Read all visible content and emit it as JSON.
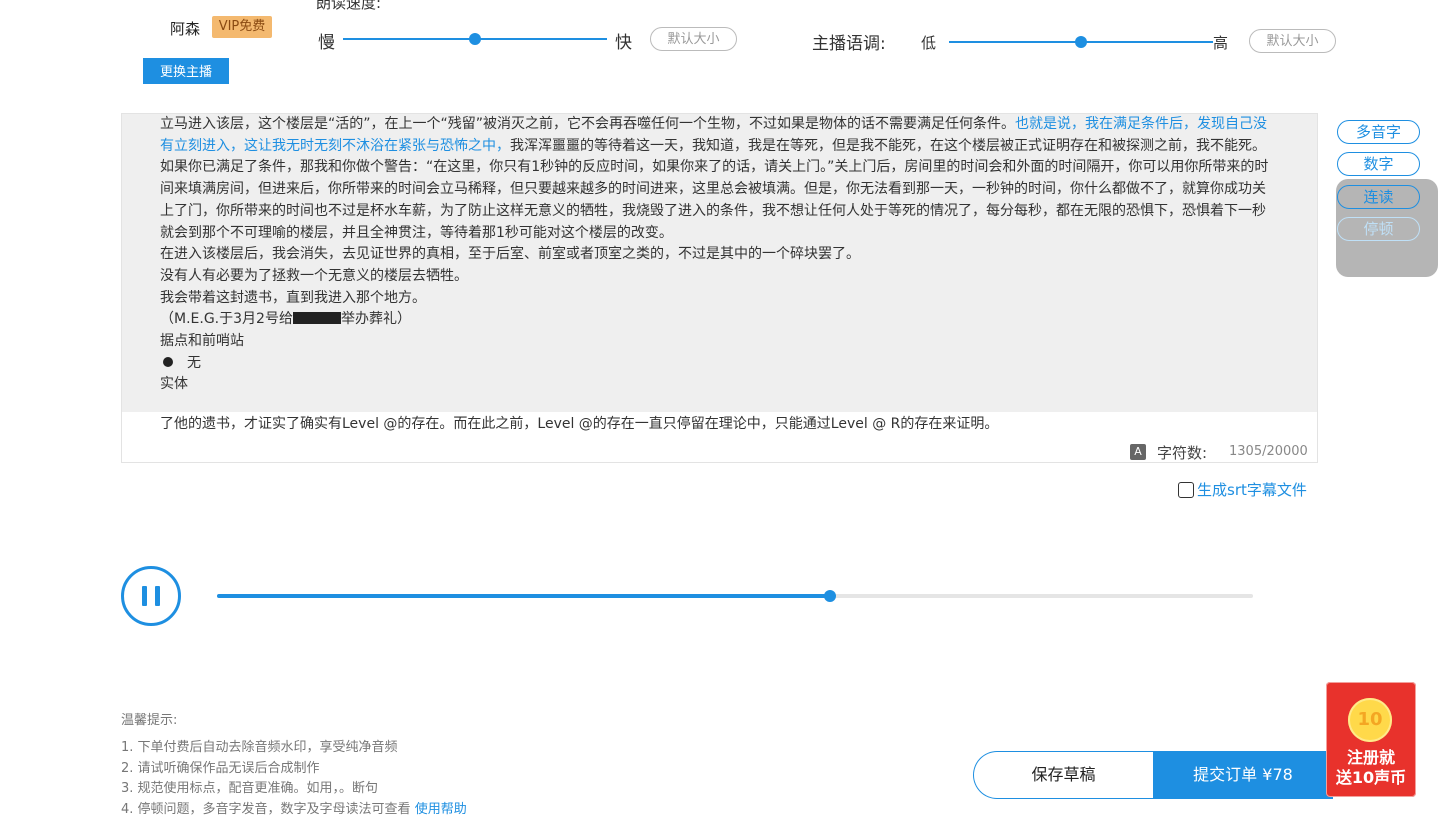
{
  "voice": {
    "name": "阿森",
    "badge": "VIP免费",
    "change_label": "更换主播",
    "speed_title": "朗读速度:"
  },
  "speed_slider": {
    "slow": "慢",
    "fast": "快",
    "reset": "默认大小",
    "value_fraction": 0.5
  },
  "tone_slider": {
    "title": "主播语调:",
    "low": "低",
    "high": "高",
    "reset": "默认大小",
    "value_fraction": 0.5
  },
  "side_tools": {
    "polyphone": "多音字",
    "number": "数字",
    "continuous": "连读",
    "pause": "停顿"
  },
  "text": {
    "p1_a": "立马进入该层，这个楼层是“活的”，在上一个“残留”被消灭之前，它不会再吞噬任何一个生物，不过如果是物体的话不需要满足任何条件。",
    "p1_hl": "也就是说，我在满足条件后，发现自己没有立刻进入，这让我无时无刻不沐浴在紧张与恐怖之中，",
    "p1_b": "我浑浑噩噩的等待着这一天，我知道，我是在等死，但是我不能死，在这个楼层被正式证明存在和被探测之前，我不能死。",
    "p2": "如果你已满足了条件，那我和你做个警告：“在这里，你只有1秒钟的反应时间，如果你来了的话，请关上门。”关上门后，房间里的时间会和外面的时间隔开，你可以用你所带来的时间来填满房间，但进来后，你所带来的时间会立马稀释，但只要越来越多的时间进来，这里总会被填满。但是，你无法看到那一天，一秒钟的时间，你什么都做不了，就算你成功关上了门，你所带来的时间也不过是杯水车薪，为了防止这样无意义的牺牲，我烧毁了进入的条件，我不想让任何人处于等死的情况了，每分每秒，都在无限的恐惧下，恐惧着下一秒就会到那个不可理喻的楼层，并且全神贯注，等待着那1秒可能对这个楼层的改变。",
    "p3": "在进入该楼层后，我会消失，去见证世界的真相，至于后室、前室或者顶室之类的，不过是其中的一个碎块罢了。",
    "p4": "没有人有必要为了拯救一个无意义的楼层去牺牲。",
    "p5": "我会带着这封遗书，直到我进入那个地方。",
    "p6_a": "（M.E.G.于3月2号给",
    "p6_b": "举办葬礼）",
    "p7": "据点和前哨站",
    "p8": "无",
    "p9": "实体",
    "under": "了他的遗书，才证实了确实有Level @的存在。而在此之前，Level @的存在一直只停留在理论中，只能通过Level @ R的存在来证明。"
  },
  "counter": {
    "icon": "A",
    "label": "字符数:",
    "value": "1305/20000"
  },
  "srt": {
    "label": "生成srt字幕文件",
    "checked": false
  },
  "player": {
    "progress_fraction": 0.592,
    "state": "playing"
  },
  "tips": {
    "title": "温馨提示:",
    "items": [
      "1. 下单付费后自动去除音频水印，享受纯净音频",
      "2. 请试听确保作品无误后合成制作",
      "3. 规范使用标点，配音更准确。如用，。断句"
    ],
    "item4": "4. 停顿问题，多音字发音，数字及字母读法可查看",
    "help_link": "使用帮助"
  },
  "actions": {
    "save": "保存草稿",
    "submit": "提交订单 ¥78"
  },
  "promo": {
    "coin": "10",
    "line1": "注册就",
    "line2": "送10声币"
  },
  "colors": {
    "accent": "#1e8fe1",
    "vip_badge": "#f4b96f",
    "promo_red": "#e8322c"
  }
}
